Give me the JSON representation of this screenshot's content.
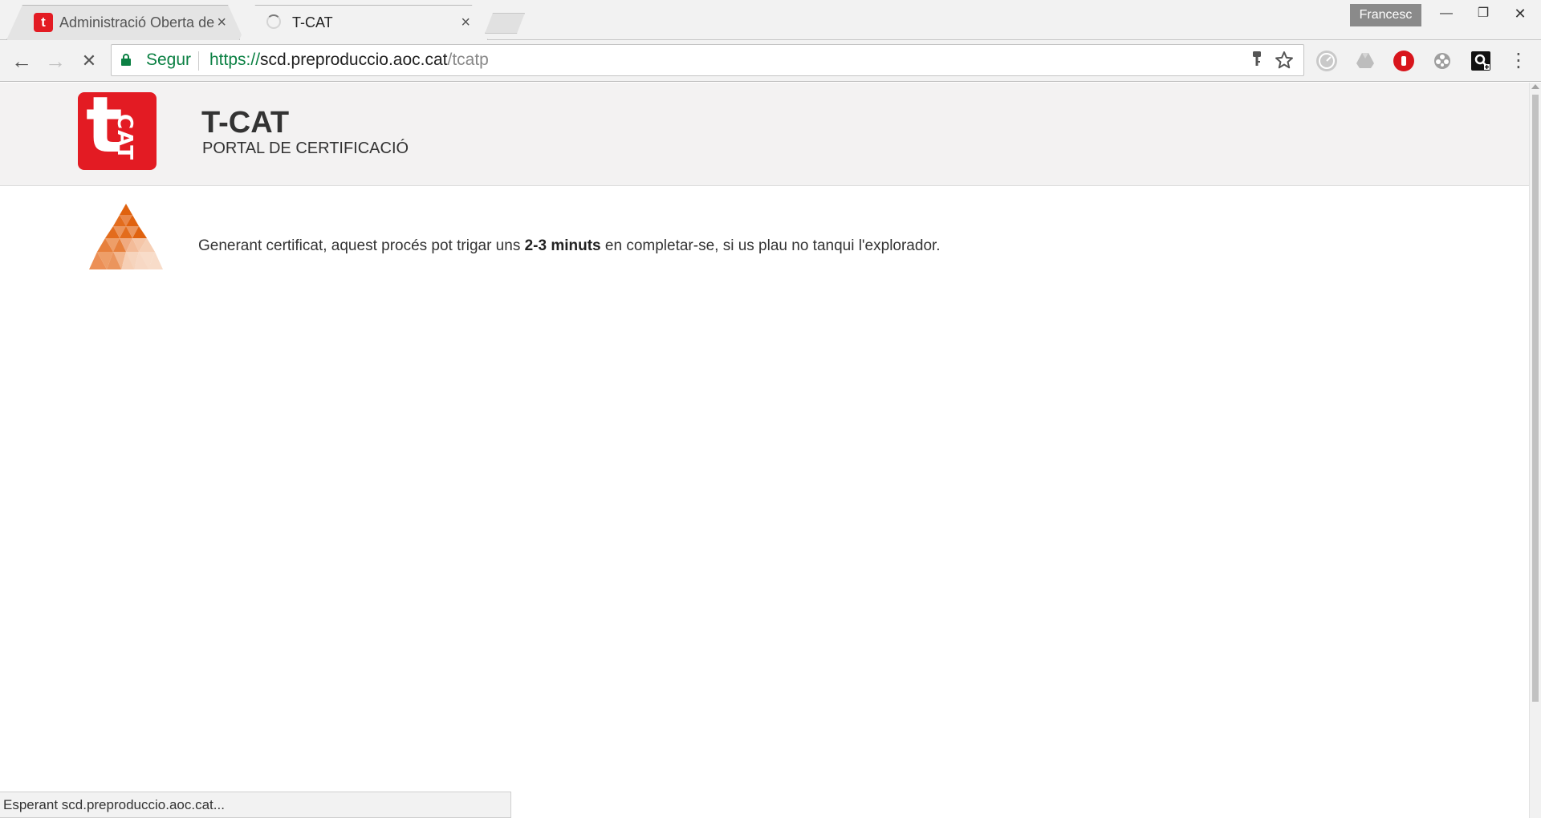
{
  "browser": {
    "tabs": [
      {
        "title": "Administració Oberta de",
        "favicon": "t",
        "active": false
      },
      {
        "title": "T-CAT",
        "active": true
      }
    ],
    "tab_close_glyph": "×",
    "profile_name": "Francesc",
    "window_controls": {
      "minimize": "—",
      "restore": "❐",
      "close": "✕"
    },
    "nav": {
      "back": "←",
      "forward": "→",
      "stop": "✕"
    },
    "omnibox": {
      "secure_label": "Segur",
      "url_scheme": "https://",
      "url_host": "scd.preproduccio.aoc.cat",
      "url_path": "/tcatp"
    },
    "menu_glyph": "⋮",
    "status_text": "Esperant scd.preproduccio.aoc.cat..."
  },
  "page": {
    "logo_letter": "t",
    "logo_sub": "CAT",
    "title": "T-CAT",
    "subtitle": "PORTAL DE CERTIFICACIÓ",
    "message_before": "Generant certificat, aquest procés pot trigar uns ",
    "message_bold": "2-3 minuts",
    "message_after": " en completar-se, si us plau no tanqui l'explorador."
  },
  "colors": {
    "brand_red": "#e31b23",
    "secure_green": "#0b8043",
    "spinner_orange": "#e0620f"
  }
}
